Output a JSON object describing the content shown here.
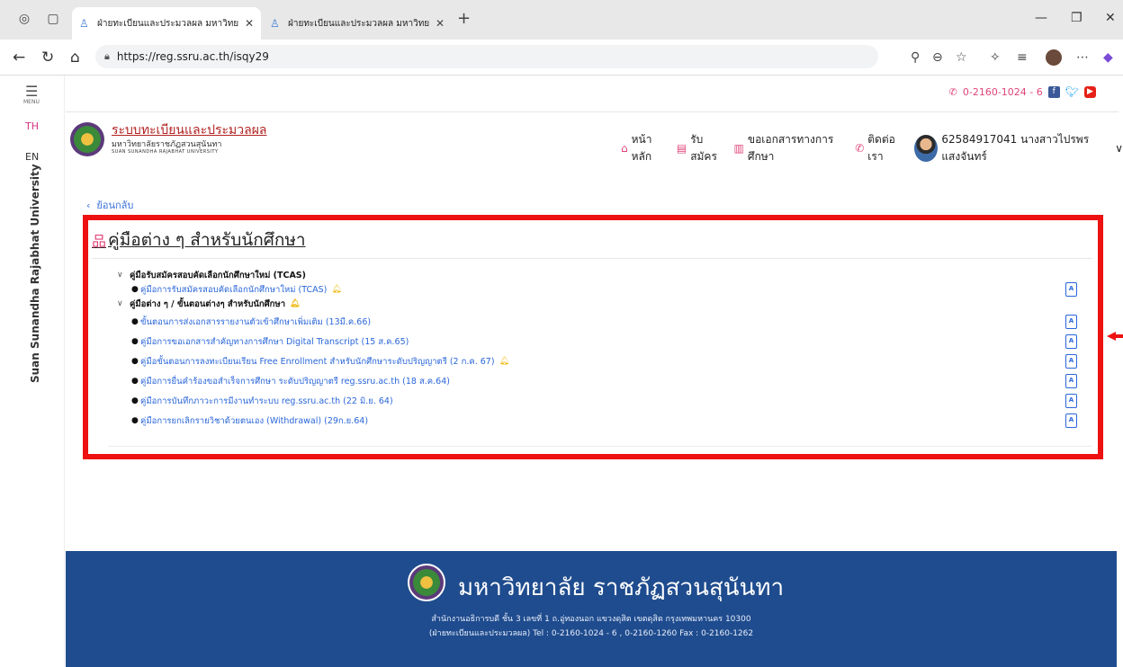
{
  "browser": {
    "tabs": [
      {
        "title": "ฝ่ายทะเบียนและประมวลผล มหาวิทยาลัย",
        "active": true
      },
      {
        "title": "ฝ่ายทะเบียนและประมวลผล มหาวิทยาลัย",
        "active": false
      }
    ],
    "url": "https://reg.ssru.ac.th/isqy29"
  },
  "rail": {
    "menu_label": "MENU",
    "lang_th": "TH",
    "lang_en": "EN",
    "vertical_text": "Suan Sunandha Rajabhat University"
  },
  "header": {
    "contact_phone": "0-2160-1024 - 6",
    "system_title": "ระบบทะเบียนและประมวลผล",
    "university_th": "มหาวิทยาลัยราชภัฏสวนสุนันทา",
    "university_en": "SUAN SUNANDHA RAJABHAT UNIVERSITY",
    "nav": {
      "home": "หน้าหลัก",
      "apply": "รับสมัคร",
      "documents": "ขอเอกสารทางการศึกษา",
      "contact": "ติดต่อเรา"
    },
    "user": "62584917041 นางสาวไปรพร แสงจันทร์"
  },
  "main": {
    "back": "ย้อนกลับ",
    "title": "คู่มือต่าง ๆ สำหรับนักศึกษา",
    "groups": [
      {
        "label": "คู่มือรับสมัครสอบคัดเลือกนักศึกษาใหม่ (TCAS)",
        "items": [
          "คู่มือการรับสมัครสอบคัดเลือกนักศึกษาใหม่ (TCAS)"
        ]
      },
      {
        "label": "คู่มือต่าง ๆ / ขั้นตอนต่างๆ สำหรับนักศึกษา",
        "items": [
          "ขั้นตอนการส่งเอกสารรายงานตัวเข้าศึกษาเพิ่มเติม (13มี.ค.66)",
          "คู่มือการขอเอกสารสำคัญทางการศึกษา Digital Transcript (15 ส.ค.65)",
          "คู่มือขั้นตอนการลงทะเบียนเรียน Free Enrollment สำหรับนักศึกษาระดับปริญญาตรี (2 ก.ค. 67)",
          "คู่มือการยื่นคำร้องขอสำเร็จการศึกษา ระดับปริญญาตรี reg.ssru.ac.th (18 ส.ค.64)",
          "คู่มือการบันทึกภาวะการมีงานทำระบบ reg.ssru.ac.th (22 มิ.ย. 64)",
          "คู่มือการยกเลิกรายวิชาด้วยตนเอง (Withdrawal) (29ก.ย.64)"
        ]
      }
    ]
  },
  "footer": {
    "name": "มหาวิทยาลัย ราชภัฏสวนสุนันทา",
    "address": "สำนักงานอธิการบดี ชั้น 3 เลขที่ 1 ถ.อู่ทองนอก แขวงดุสิต เขตดุสิต กรุงเทพมหานคร 10300",
    "phones": "(ฝ่ายทะเบียนและประมวลผล) Tel : 0-2160-1024 - 6 , 0-2160-1260   Fax : 0-2160-1262"
  },
  "colors": {
    "accent_pink": "#e0457b",
    "link_blue": "#2a66d9",
    "highlight_red": "#ee1111",
    "footer_blue": "#1f4c8e"
  }
}
